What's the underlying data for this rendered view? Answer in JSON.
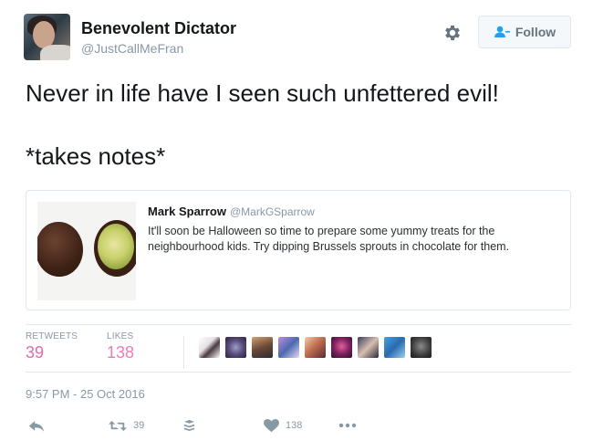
{
  "author": {
    "name": "Benevolent Dictator",
    "handle": "@JustCallMeFran"
  },
  "follow_button": {
    "label": "Follow",
    "icon": "follow-person-icon"
  },
  "tweet": {
    "line1": "Never in life have I seen such unfettered evil!",
    "line2": "*takes notes*"
  },
  "quoted_tweet": {
    "author": "Mark Sparrow",
    "handle": "@MarkGSparrow",
    "text": "It'll soon be Halloween so time to prepare some yummy treats for the neighbourhood kids. Try dipping Brussels sprouts in chocolate for them."
  },
  "stats": {
    "retweets_label": "RETWEETS",
    "retweets": "39",
    "likes_label": "LIKES",
    "likes": "138"
  },
  "timestamp": "9:57 PM - 25 Oct 2016",
  "actions": {
    "reply_icon": "reply-icon",
    "retweet_count": "39",
    "like_count": "138"
  },
  "colors": {
    "count_accent": "#e86aae",
    "follow_icon": "#1da1f2",
    "muted": "#8899a6"
  }
}
